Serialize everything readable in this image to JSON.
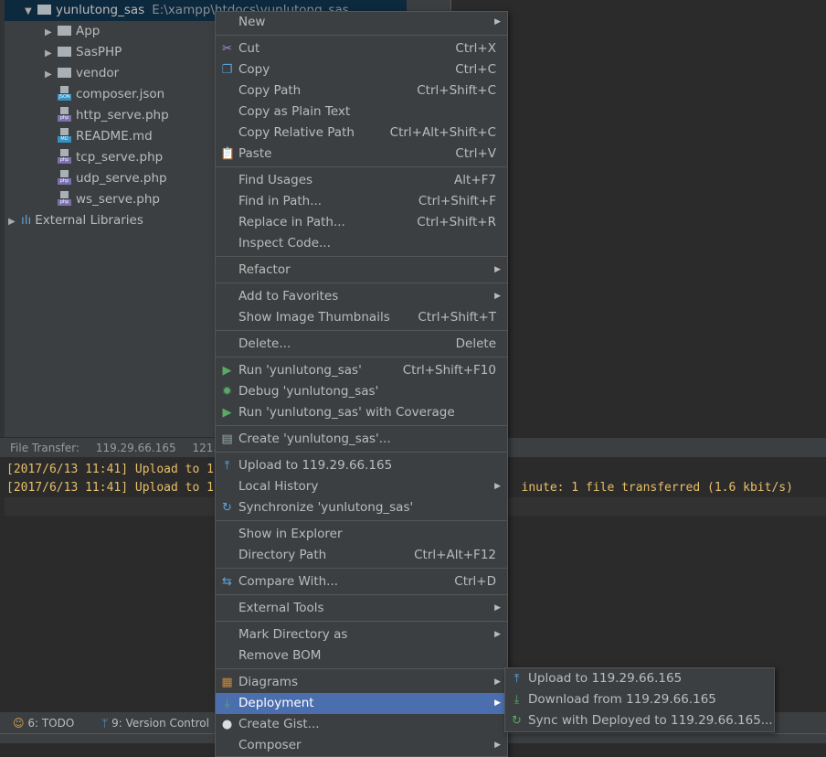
{
  "tree": {
    "root": {
      "name": "yunlutong_sas",
      "path": "E:\\xampp\\htdocs\\yunlutong_sas"
    },
    "items": [
      {
        "name": "App",
        "type": "folder"
      },
      {
        "name": "SasPHP",
        "type": "folder"
      },
      {
        "name": "vendor",
        "type": "folder"
      },
      {
        "name": "composer.json",
        "type": "file",
        "badge": "JSON",
        "color": "#3592c4"
      },
      {
        "name": "http_serve.php",
        "type": "file",
        "badge": "php",
        "color": "#7c6fb0"
      },
      {
        "name": "README.md",
        "type": "file",
        "badge": "MD",
        "color": "#3592c4"
      },
      {
        "name": "tcp_serve.php",
        "type": "file",
        "badge": "php",
        "color": "#7c6fb0"
      },
      {
        "name": "udp_serve.php",
        "type": "file",
        "badge": "php",
        "color": "#7c6fb0"
      },
      {
        "name": "ws_serve.php",
        "type": "file",
        "badge": "php",
        "color": "#7c6fb0"
      }
    ],
    "external": "External Libraries"
  },
  "tool_window": {
    "label": "File Transfer:",
    "tabs": [
      "119.29.66.165",
      "121.41"
    ]
  },
  "console": {
    "lines": [
      "[2017/6/13 11:41] Upload to 1",
      "[2017/6/13 11:41] Upload to 1                                           inute: 1 file transferred (1.6 kbit/s)"
    ]
  },
  "bottom_bar": {
    "todo": "6: TODO",
    "vcs": "9: Version Control"
  },
  "context_menu": {
    "items": [
      {
        "label": "New",
        "sub": true
      },
      {
        "sep": true
      },
      {
        "label": "Cut",
        "shortcut": "Ctrl+X",
        "icon": "scissors-icon",
        "glyph": "✂",
        "color": "#b08acf"
      },
      {
        "label": "Copy",
        "shortcut": "Ctrl+C",
        "icon": "copy-icon",
        "glyph": "❐",
        "color": "#5fa3d8"
      },
      {
        "label": "Copy Path",
        "shortcut": "Ctrl+Shift+C"
      },
      {
        "label": "Copy as Plain Text"
      },
      {
        "label": "Copy Relative Path",
        "shortcut": "Ctrl+Alt+Shift+C"
      },
      {
        "label": "Paste",
        "shortcut": "Ctrl+V",
        "icon": "paste-icon",
        "glyph": "📋",
        "color": "#d8a24a"
      },
      {
        "sep": true
      },
      {
        "label": "Find Usages",
        "shortcut": "Alt+F7"
      },
      {
        "label": "Find in Path...",
        "shortcut": "Ctrl+Shift+F"
      },
      {
        "label": "Replace in Path...",
        "shortcut": "Ctrl+Shift+R"
      },
      {
        "label": "Inspect Code..."
      },
      {
        "sep": true
      },
      {
        "label": "Refactor",
        "sub": true
      },
      {
        "sep": true
      },
      {
        "label": "Add to Favorites",
        "sub": true
      },
      {
        "label": "Show Image Thumbnails",
        "shortcut": "Ctrl+Shift+T"
      },
      {
        "sep": true
      },
      {
        "label": "Delete...",
        "shortcut": "Delete"
      },
      {
        "sep": true
      },
      {
        "label": "Run 'yunlutong_sas'",
        "shortcut": "Ctrl+Shift+F10",
        "icon": "run-icon",
        "glyph": "▶",
        "color": "#59a869"
      },
      {
        "label": "Debug 'yunlutong_sas'",
        "icon": "debug-icon",
        "glyph": "✹",
        "color": "#59a869"
      },
      {
        "label": "Run 'yunlutong_sas' with Coverage",
        "icon": "coverage-icon",
        "glyph": "▶",
        "color": "#59a869"
      },
      {
        "sep": true
      },
      {
        "label": "Create 'yunlutong_sas'...",
        "icon": "create-config-icon",
        "glyph": "▤",
        "color": "#9aa"
      },
      {
        "sep": true
      },
      {
        "label": "Upload to 119.29.66.165",
        "icon": "upload-icon",
        "glyph": "⤒",
        "color": "#5fa3d8"
      },
      {
        "label": "Local History",
        "sub": true
      },
      {
        "label": "Synchronize 'yunlutong_sas'",
        "icon": "sync-icon",
        "glyph": "↻",
        "color": "#5fa3d8"
      },
      {
        "sep": true
      },
      {
        "label": "Show in Explorer"
      },
      {
        "label": "Directory Path",
        "shortcut": "Ctrl+Alt+F12"
      },
      {
        "sep": true
      },
      {
        "label": "Compare With...",
        "shortcut": "Ctrl+D",
        "icon": "compare-icon",
        "glyph": "⇆",
        "color": "#5fa3d8"
      },
      {
        "sep": true
      },
      {
        "label": "External Tools",
        "sub": true
      },
      {
        "sep": true
      },
      {
        "label": "Mark Directory as",
        "sub": true
      },
      {
        "label": "Remove BOM"
      },
      {
        "sep": true
      },
      {
        "label": "Diagrams",
        "sub": true,
        "icon": "diagrams-icon",
        "glyph": "▦",
        "color": "#c9893a"
      },
      {
        "label": "Deployment",
        "sub": true,
        "active": true,
        "icon": "deployment-icon",
        "glyph": "⤓",
        "color": "#59a869"
      },
      {
        "label": "Create Gist...",
        "icon": "github-icon",
        "glyph": "●",
        "color": "#ddd"
      },
      {
        "label": "Composer",
        "sub": true
      }
    ]
  },
  "deployment_submenu": {
    "items": [
      {
        "label": "Upload to 119.29.66.165",
        "icon": "upload-icon",
        "glyph": "⤒",
        "color": "#5fa3d8"
      },
      {
        "label": "Download from 119.29.66.165",
        "icon": "download-icon",
        "glyph": "⤓",
        "color": "#59a869"
      },
      {
        "label": "Sync with Deployed to 119.29.66.165...",
        "icon": "sync-icon",
        "glyph": "↻",
        "color": "#59a869"
      }
    ]
  },
  "colors": {
    "accent": "#4b6eaf",
    "console_text": "#e8bf6a"
  }
}
